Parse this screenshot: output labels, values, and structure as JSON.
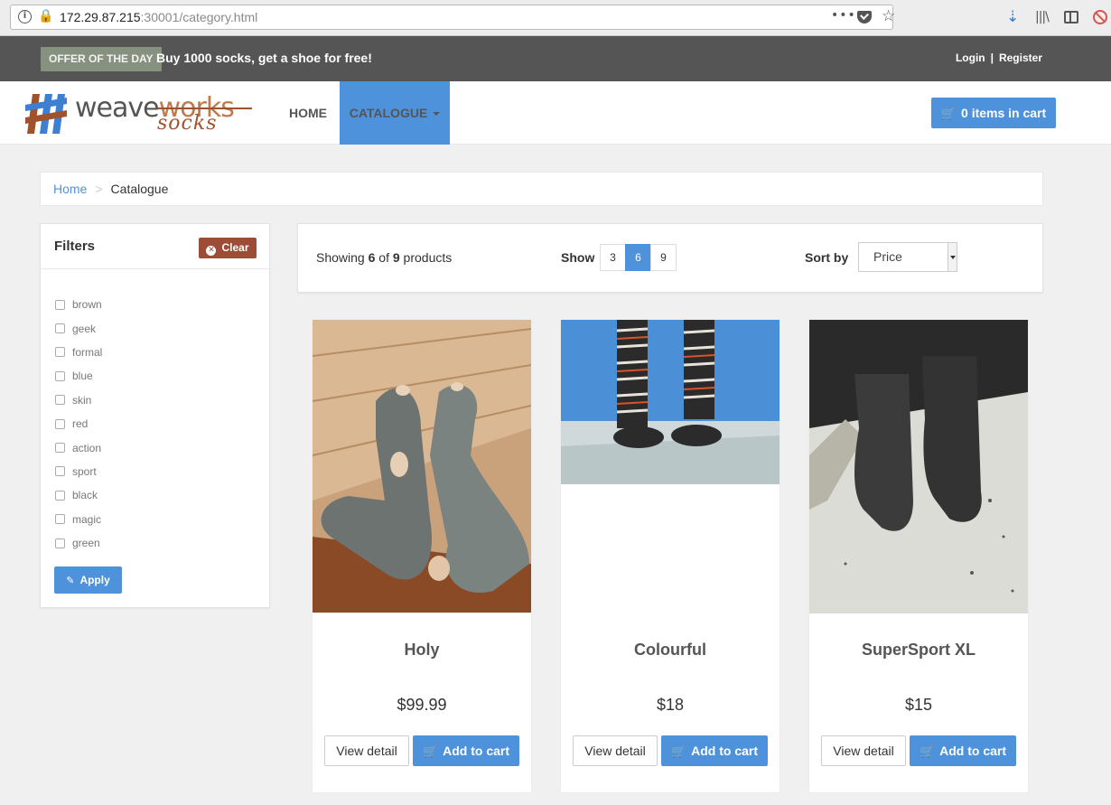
{
  "browser": {
    "url_host": "172.29.87.215",
    "url_rest": ":30001/category.html",
    "more_glyph": "•••"
  },
  "topbar": {
    "offer_badge": "OFFER OF THE DAY",
    "offer_text": "Buy 1000 socks, get a shoe for free!",
    "login": "Login",
    "separator": "|",
    "register": "Register"
  },
  "nav": {
    "logo_weave": "weave",
    "logo_works": "works",
    "logo_socks": "socks",
    "home": "HOME",
    "catalogue": "CATALOGUE",
    "cart_label": "0 items in cart"
  },
  "breadcrumb": {
    "home": "Home",
    "current": "Catalogue"
  },
  "filters": {
    "title": "Filters",
    "clear_label": "Clear",
    "apply_label": "Apply",
    "items": [
      {
        "label": "brown"
      },
      {
        "label": "geek"
      },
      {
        "label": "formal"
      },
      {
        "label": "blue"
      },
      {
        "label": "skin"
      },
      {
        "label": "red"
      },
      {
        "label": "action"
      },
      {
        "label": "sport"
      },
      {
        "label": "black"
      },
      {
        "label": "magic"
      },
      {
        "label": "green"
      }
    ]
  },
  "listing": {
    "showing_prefix": "Showing ",
    "showing_count": "6",
    "showing_of": " of ",
    "showing_total": "9",
    "showing_suffix": " products",
    "show_label": "Show",
    "page_sizes": [
      "3",
      "6",
      "9"
    ],
    "sort_label": "Sort by",
    "sort_value": "Price"
  },
  "products": [
    {
      "name": "Holy",
      "price": "$99.99",
      "detail_label": "View detail",
      "cart_label": "Add to cart"
    },
    {
      "name": "Colourful",
      "price": "$18",
      "detail_label": "View detail",
      "cart_label": "Add to cart"
    },
    {
      "name": "SuperSport XL",
      "price": "$15",
      "detail_label": "View detail",
      "cart_label": "Add to cart"
    }
  ],
  "colors": {
    "accent": "#4f92dc",
    "clear_button": "#9d4c35",
    "topbar": "#555555",
    "offer_badge": "#879180"
  }
}
